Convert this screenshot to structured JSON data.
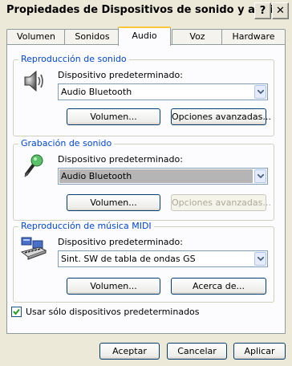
{
  "window": {
    "title": "Propiedades de Dispositivos de sonido y audio"
  },
  "titlebar_buttons": {
    "help": "?",
    "close": "✕"
  },
  "tabs": [
    {
      "label": "Volumen"
    },
    {
      "label": "Sonidos"
    },
    {
      "label": "Audio",
      "active": true
    },
    {
      "label": "Voz"
    },
    {
      "label": "Hardware"
    }
  ],
  "playback": {
    "title": "Reproducción de sonido",
    "device_label": "Dispositivo predeterminado:",
    "device_value": "Audio Bluetooth",
    "volume_button": "Volumen...",
    "advanced_button": "Opciones avanzadas..."
  },
  "recording": {
    "title": "Grabación de sonido",
    "device_label": "Dispositivo predeterminado:",
    "device_value": "Audio Bluetooth",
    "volume_button": "Volumen...",
    "advanced_button": "Opciones avanzadas..."
  },
  "midi": {
    "title": "Reproducción de música MIDI",
    "device_label": "Dispositivo predeterminado:",
    "device_value": "Sint. SW de tabla de ondas GS",
    "volume_button": "Volumen...",
    "about_button": "Acerca de..."
  },
  "default_only": {
    "label": "Usar sólo dispositivos predeterminados",
    "checked": true
  },
  "footer": {
    "ok": "Aceptar",
    "cancel": "Cancelar",
    "apply": "Aplicar"
  }
}
